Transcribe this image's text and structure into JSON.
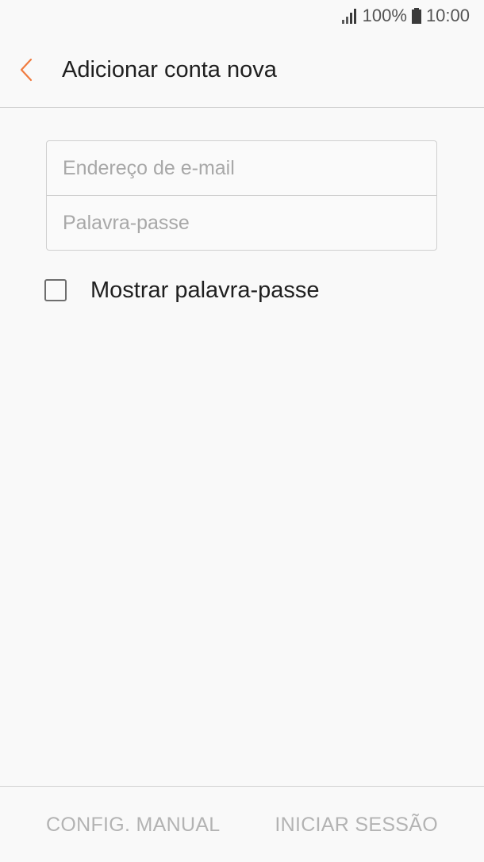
{
  "status_bar": {
    "battery": "100%",
    "time": "10:00",
    "icons": [
      "signal-icon",
      "battery-icon"
    ]
  },
  "app_bar": {
    "title": "Adicionar conta nova",
    "back_icon": "chevron-left-icon",
    "accent_color": "#f07b3f"
  },
  "form": {
    "email": {
      "value": "",
      "placeholder": "Endereço de e-mail"
    },
    "password": {
      "value": "",
      "placeholder": "Palavra-passe"
    },
    "show_password": {
      "label": "Mostrar palavra-passe",
      "checked": false
    }
  },
  "bottom_bar": {
    "manual_label": "CONFIG. MANUAL",
    "signin_label": "INICIAR SESSÃO"
  }
}
